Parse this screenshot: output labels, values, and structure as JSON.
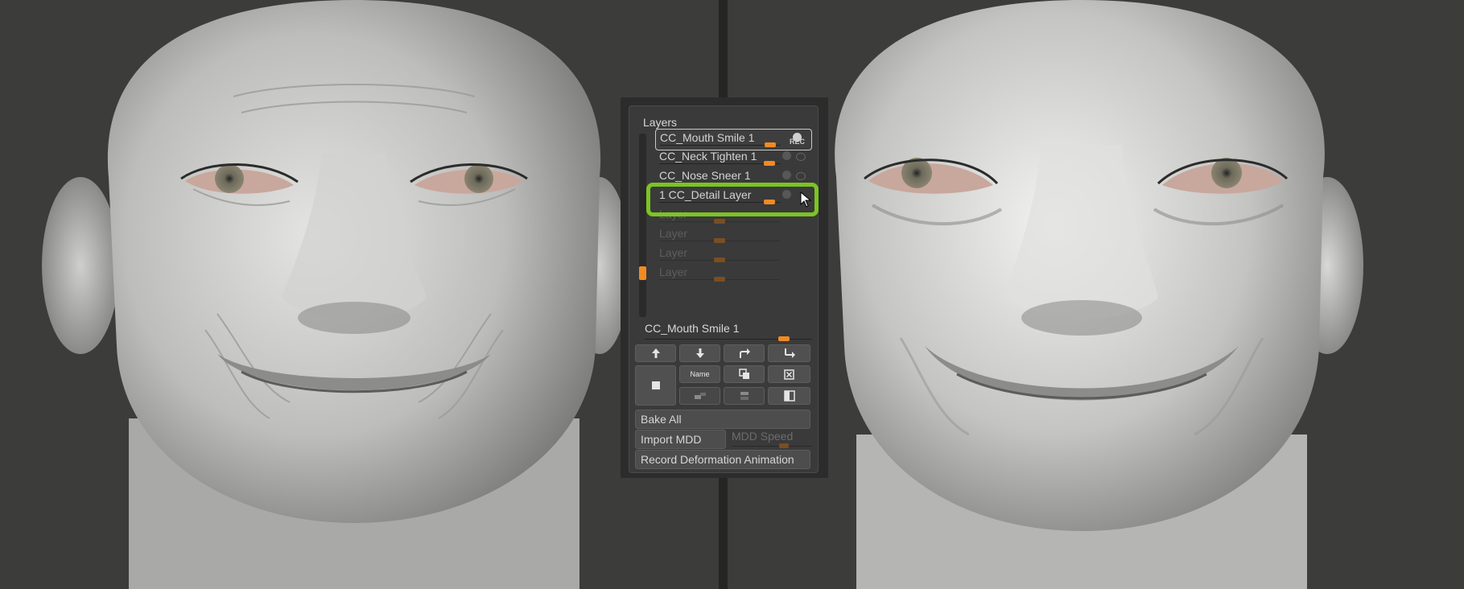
{
  "panel": {
    "title": "Layers",
    "layers": [
      {
        "name": "CC_Mouth Smile 1",
        "strength": 0.88,
        "state": "active",
        "badge": "REC"
      },
      {
        "name": "CC_Neck Tighten 1",
        "strength": 0.88,
        "state": "normal"
      },
      {
        "name": "CC_Nose Sneer 1",
        "strength": 0.88,
        "state": "normal"
      },
      {
        "name": "1 CC_Detail Layer",
        "strength": 0.88,
        "state": "highlighted"
      },
      {
        "name": "Layer",
        "strength": 0.48,
        "state": "empty"
      },
      {
        "name": "Layer",
        "strength": 0.48,
        "state": "empty"
      },
      {
        "name": "Layer",
        "strength": 0.48,
        "state": "empty"
      },
      {
        "name": "Layer",
        "strength": 0.48,
        "state": "empty"
      }
    ],
    "selected_layer_name": "CC_Mouth Smile 1",
    "selected_strength": 0.8,
    "buttons": {
      "name_label": "Name",
      "bake_all": "Bake All",
      "import_mdd": "Import MDD",
      "mdd_speed": "MDD Speed",
      "record_deformation": "Record Deformation Animation"
    },
    "highlight_color": "#7cc423",
    "accent_color": "#f08a24"
  }
}
